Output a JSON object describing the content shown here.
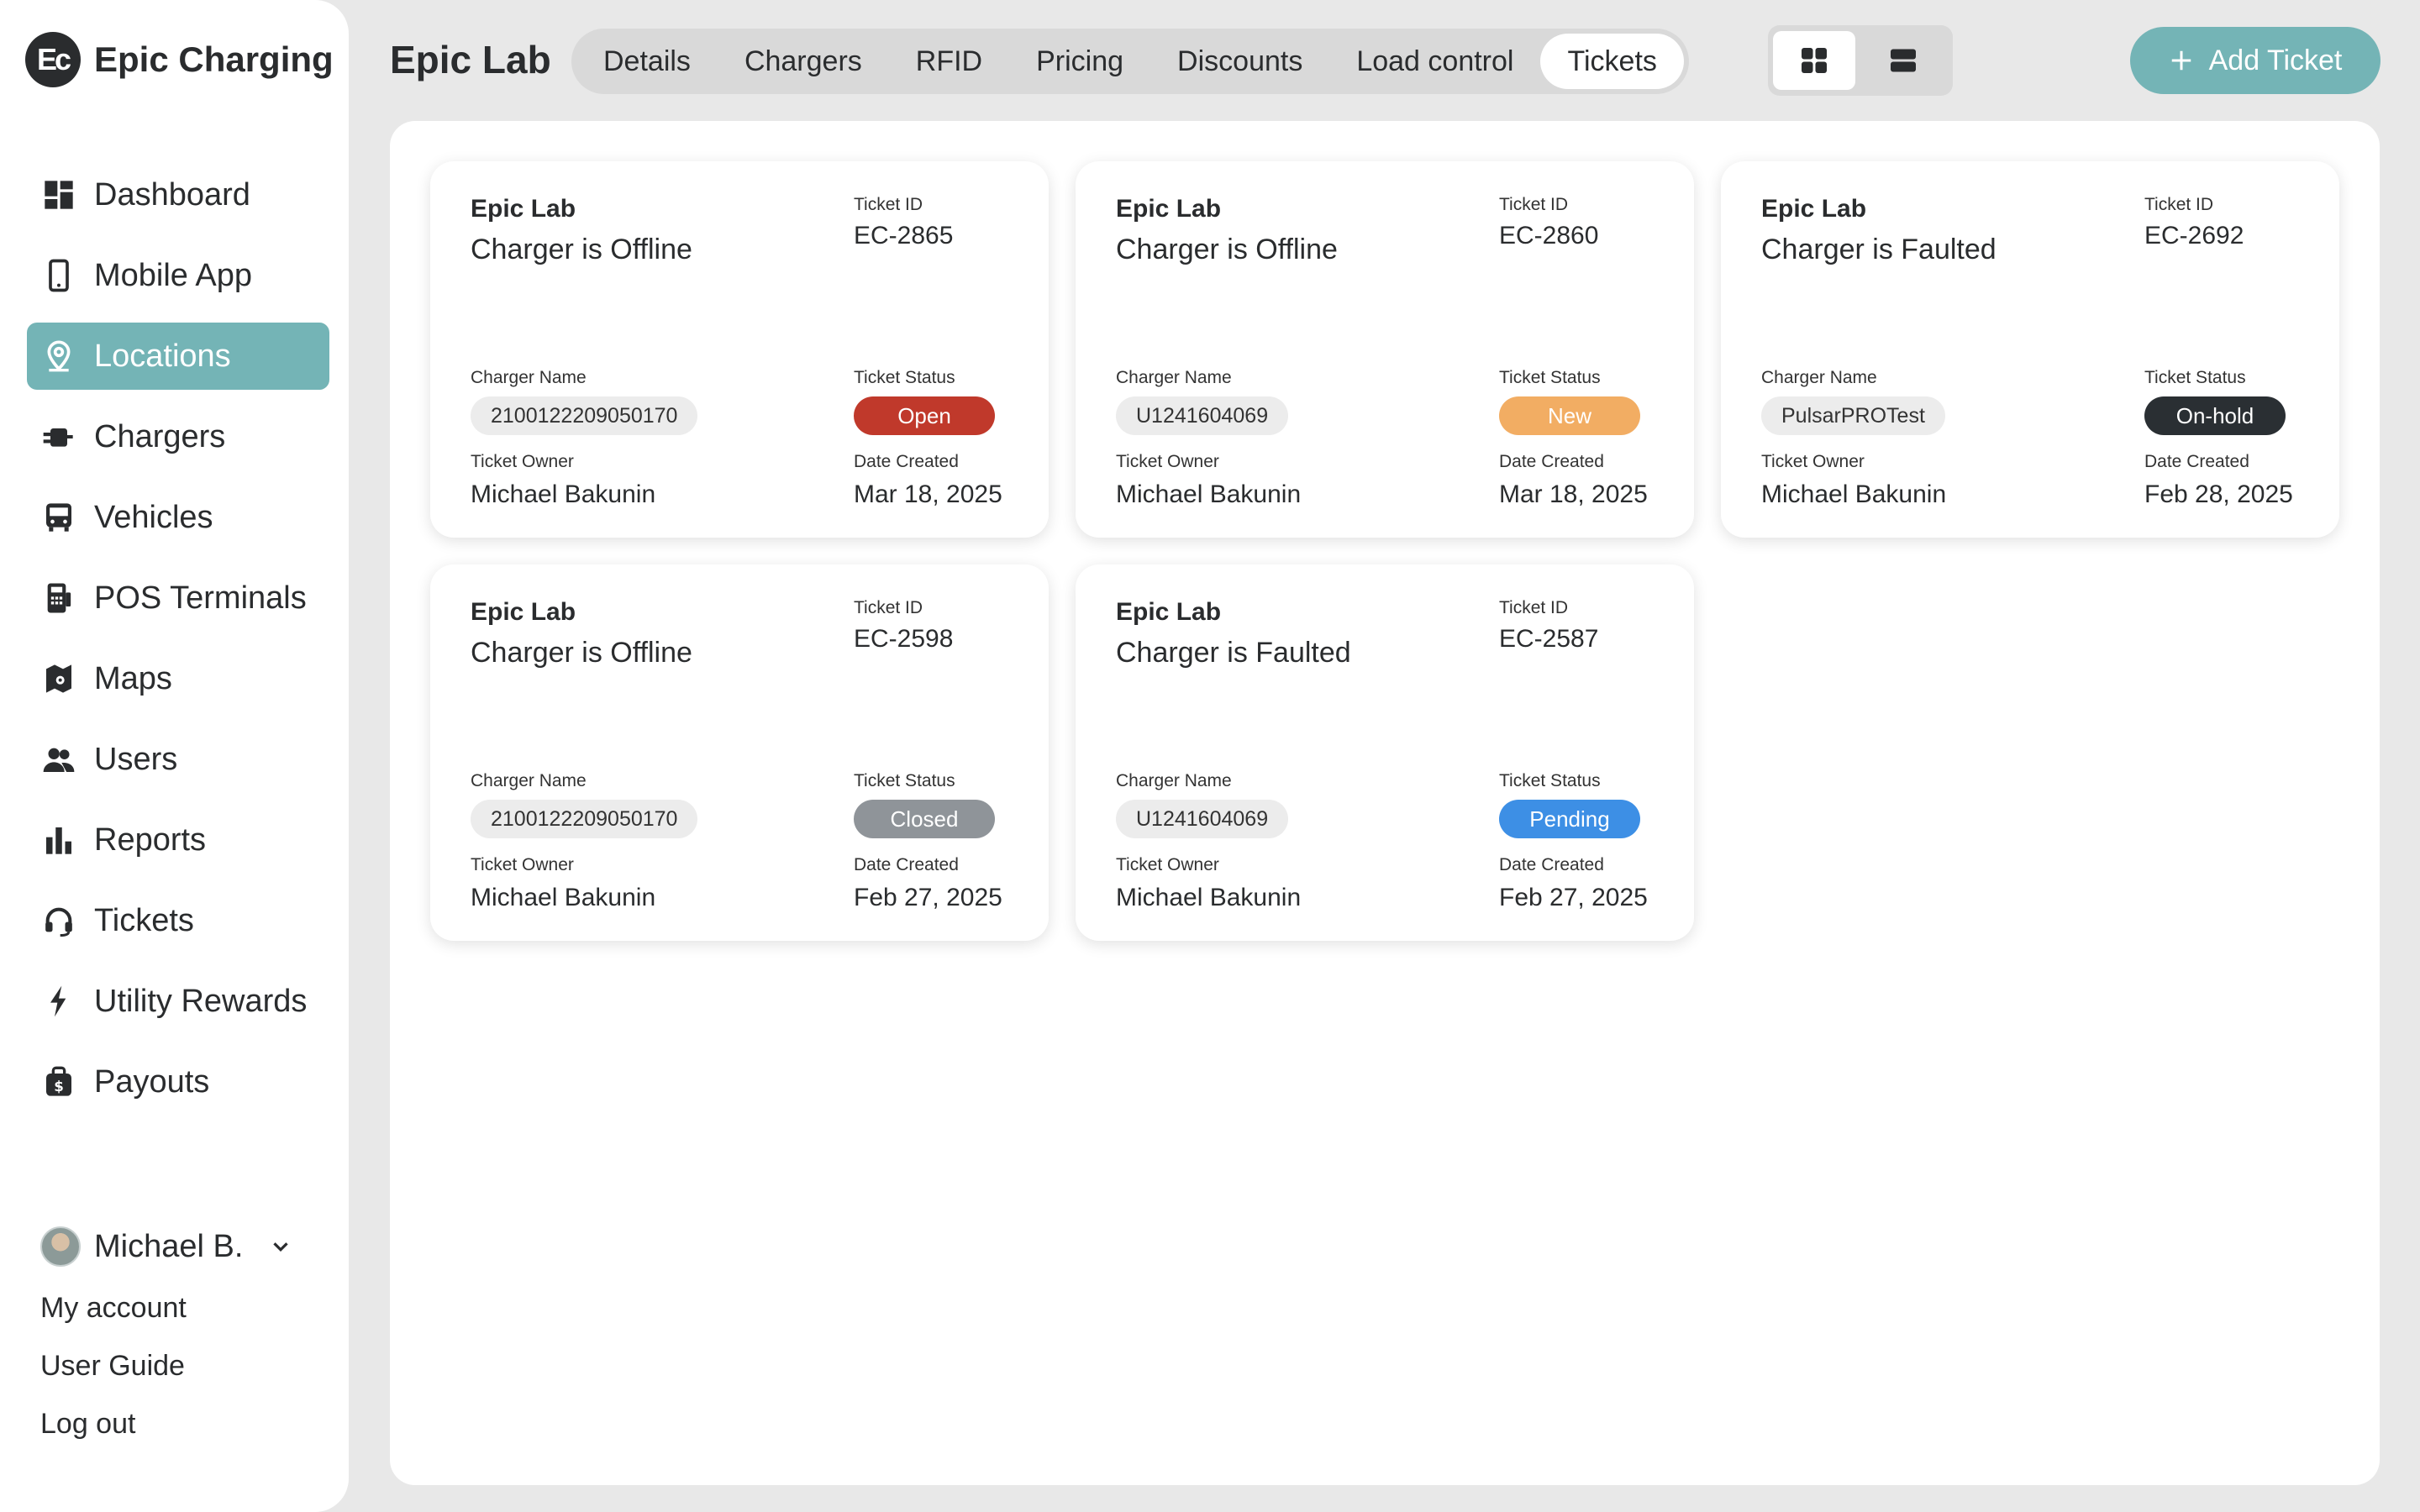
{
  "brand": {
    "logo_text": "Ec",
    "name": "Epic Charging"
  },
  "sidebar": {
    "items": [
      {
        "label": "Dashboard",
        "icon": "dashboard-icon"
      },
      {
        "label": "Mobile App",
        "icon": "mobile-icon"
      },
      {
        "label": "Locations",
        "icon": "location-pin-icon",
        "active": true
      },
      {
        "label": "Chargers",
        "icon": "charger-plug-icon"
      },
      {
        "label": "Vehicles",
        "icon": "bus-icon"
      },
      {
        "label": "POS Terminals",
        "icon": "pos-terminal-icon"
      },
      {
        "label": "Maps",
        "icon": "map-icon"
      },
      {
        "label": "Users",
        "icon": "users-icon"
      },
      {
        "label": "Reports",
        "icon": "bar-chart-icon"
      },
      {
        "label": "Tickets",
        "icon": "headset-icon"
      },
      {
        "label": "Utility Rewards",
        "icon": "lightning-icon"
      },
      {
        "label": "Payouts",
        "icon": "wallet-icon"
      }
    ]
  },
  "user": {
    "name": "Michael B.",
    "links": [
      "My account",
      "User Guide",
      "Log out"
    ]
  },
  "header": {
    "title": "Epic Lab",
    "tabs": [
      "Details",
      "Chargers",
      "RFID",
      "Pricing",
      "Discounts",
      "Load control",
      "Tickets"
    ],
    "active_tab": "Tickets",
    "add_button": "Add Ticket"
  },
  "labels": {
    "ticket_id": "Ticket ID",
    "charger_name": "Charger Name",
    "ticket_status": "Ticket Status",
    "ticket_owner": "Ticket Owner",
    "date_created": "Date Created"
  },
  "colors": {
    "accent": "#74b4b6",
    "open": "#c0392b",
    "new": "#f2ad63",
    "on_hold": "#2a2f33",
    "closed": "#8f9499",
    "pending": "#3d8fe5"
  },
  "tickets": [
    {
      "location": "Epic Lab",
      "issue": "Charger is Offline",
      "id": "EC-2865",
      "charger": "2100122209050170",
      "status": "Open",
      "status_color": "#c0392b",
      "owner": "Michael Bakunin",
      "date": "Mar 18, 2025"
    },
    {
      "location": "Epic Lab",
      "issue": "Charger is Offline",
      "id": "EC-2860",
      "charger": "U1241604069",
      "status": "New",
      "status_color": "#f2ad63",
      "owner": "Michael Bakunin",
      "date": "Mar 18, 2025"
    },
    {
      "location": "Epic Lab",
      "issue": "Charger is Faulted",
      "id": "EC-2692",
      "charger": "PulsarPROTest",
      "status": "On-hold",
      "status_color": "#2a2f33",
      "owner": "Michael Bakunin",
      "date": "Feb 28, 2025"
    },
    {
      "location": "Epic Lab",
      "issue": "Charger is Offline",
      "id": "EC-2598",
      "charger": "2100122209050170",
      "status": "Closed",
      "status_color": "#8f9499",
      "owner": "Michael Bakunin",
      "date": "Feb 27, 2025"
    },
    {
      "location": "Epic Lab",
      "issue": "Charger is Faulted",
      "id": "EC-2587",
      "charger": "U1241604069",
      "status": "Pending",
      "status_color": "#3d8fe5",
      "owner": "Michael Bakunin",
      "date": "Feb 27, 2025"
    }
  ]
}
